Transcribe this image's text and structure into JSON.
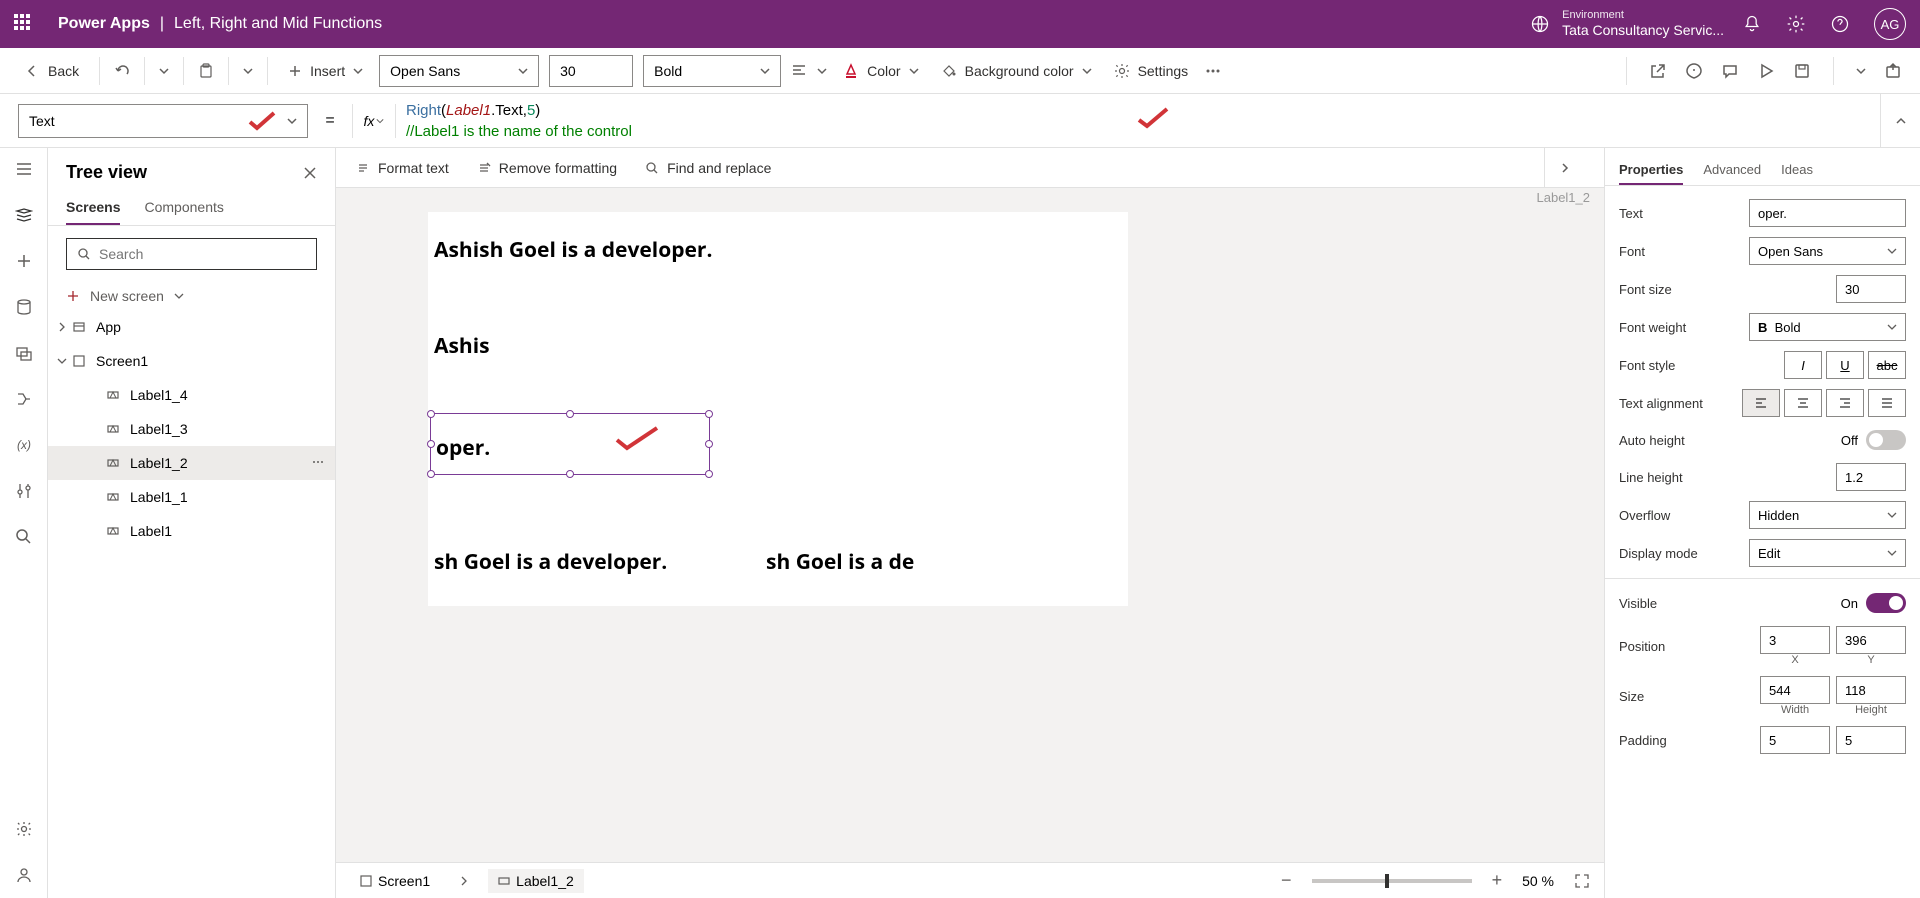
{
  "header": {
    "app": "Power Apps",
    "sep": "|",
    "name": "Left, Right and Mid Functions",
    "env_label": "Environment",
    "env_name": "Tata Consultancy Servic...",
    "avatar": "AG"
  },
  "toolbar": {
    "back": "Back",
    "insert": "Insert",
    "font": "Open Sans",
    "size": "30",
    "weight": "Bold",
    "color": "Color",
    "bgcolor": "Background color",
    "settings": "Settings"
  },
  "propbar": {
    "property": "Text",
    "formula_parts": {
      "func": "Right",
      "open": "(",
      "ident": "Label1",
      "dot": ".Text,",
      "num": "5",
      "close": ")",
      "comment": "//Label1 is the name of the control"
    }
  },
  "tree": {
    "title": "Tree view",
    "tab_screens": "Screens",
    "tab_components": "Components",
    "search_ph": "Search",
    "new_screen": "New screen",
    "items": {
      "app": "App",
      "screen": "Screen1",
      "l4": "Label1_4",
      "l3": "Label1_3",
      "l2": "Label1_2",
      "l1": "Label1_1",
      "l0": "Label1"
    }
  },
  "canvasbar": {
    "format": "Format text",
    "remove": "Remove formatting",
    "find": "Find and replace"
  },
  "canvas": {
    "t1": "Ashish Goel is a developer.",
    "t2": "Ashis",
    "t3": "oper.",
    "t4": "sh Goel is a developer.",
    "t5": "sh Goel is a de"
  },
  "footer": {
    "screen": "Screen1",
    "selected": "Label1_2",
    "zoom": "50",
    "pct": "%"
  },
  "rpanel": {
    "name": "Label1_2",
    "tab_props": "Properties",
    "tab_adv": "Advanced",
    "tab_ideas": "Ideas",
    "fields": {
      "text_l": "Text",
      "text_v": "oper.",
      "font_l": "Font",
      "font_v": "Open Sans",
      "fsize_l": "Font size",
      "fsize_v": "30",
      "fweight_l": "Font weight",
      "fweight_v": "Bold",
      "fstyle_l": "Font style",
      "talign_l": "Text alignment",
      "autoh_l": "Auto height",
      "autoh_v": "Off",
      "lheight_l": "Line height",
      "lheight_v": "1.2",
      "overflow_l": "Overflow",
      "overflow_v": "Hidden",
      "dmode_l": "Display mode",
      "dmode_v": "Edit",
      "visible_l": "Visible",
      "visible_v": "On",
      "pos_l": "Position",
      "pos_x": "3",
      "pos_y": "396",
      "pos_xl": "X",
      "pos_yl": "Y",
      "size_l": "Size",
      "size_w": "544",
      "size_h": "118",
      "size_wl": "Width",
      "size_hl": "Height",
      "padding_l": "Padding",
      "padding_t": "5",
      "padding_b": "5"
    }
  }
}
